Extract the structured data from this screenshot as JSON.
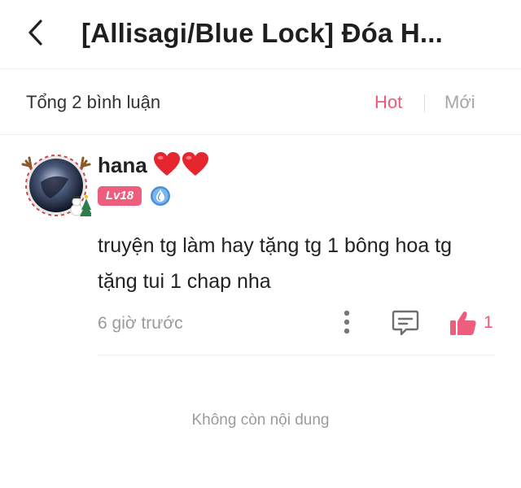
{
  "header": {
    "title": "[Allisagi/Blue Lock] Đóa H...",
    "back_icon": "chevron-left-icon"
  },
  "sort_bar": {
    "total_label": "Tổng 2 bình luận",
    "hot_label": "Hot",
    "new_label": "Mới",
    "active_color": "#ee5a78",
    "inactive_color": "#a6a6a6"
  },
  "comments": [
    {
      "username": "hana",
      "username_emoji": "heart-icon",
      "level": "Lv18",
      "level_color": "#ec5d7e",
      "badge_icon": "water-drop-badge-icon",
      "text": "truyện tg làm hay tặng tg 1 bông hoa tg tặng tui 1 chap nha",
      "timestamp": "6 giờ trước",
      "like_count": "1"
    }
  ],
  "footer": {
    "end_text": "Không còn nội dung"
  }
}
